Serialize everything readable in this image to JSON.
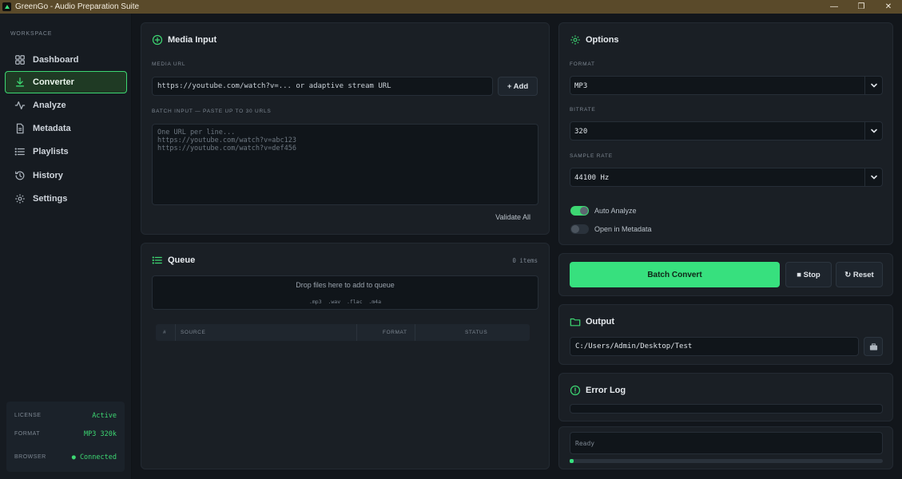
{
  "window": {
    "title": "GreenGo - Audio Preparation Suite",
    "controls": [
      "—",
      "❐",
      "✕"
    ]
  },
  "sidebar": {
    "section_label": "WORKSPACE",
    "items": [
      {
        "label": "Dashboard",
        "icon": "dashboard-icon"
      },
      {
        "label": "Converter",
        "icon": "download-icon",
        "active": true
      },
      {
        "label": "Analyze",
        "icon": "waveform-icon"
      },
      {
        "label": "Metadata",
        "icon": "document-icon"
      },
      {
        "label": "Playlists",
        "icon": "list-icon"
      },
      {
        "label": "History",
        "icon": "history-icon"
      },
      {
        "label": "Settings",
        "icon": "gear-icon"
      }
    ],
    "footer": {
      "license_label": "LICENSE",
      "license_value": "Active",
      "format_label": "FORMAT",
      "format_value": "MP3 320k",
      "browser_label": "BROWSER",
      "browser_value": "● Connected"
    }
  },
  "media_input": {
    "title": "Media Input",
    "url_label": "MEDIA URL",
    "url_placeholder": "https://youtube.com/watch?v=... or adaptive stream URL",
    "add_button": "+ Add",
    "batch_label": "BATCH INPUT — PASTE UP TO 30 URLS",
    "batch_placeholder": "One URL per line...\nhttps://youtube.com/watch?v=abc123\nhttps://youtube.com/watch?v=def456",
    "validate_button": "Validate All"
  },
  "queue": {
    "title": "Queue",
    "count": "0 items",
    "drop_text": "Drop files here to add to queue",
    "drop_formats": ".mp3  .wav  .flac  .m4a",
    "columns": [
      "#",
      "SOURCE",
      "FORMAT",
      "STATUS"
    ]
  },
  "options": {
    "title": "Options",
    "format_label": "FORMAT",
    "format_value": "MP3",
    "bitrate_label": "BITRATE",
    "bitrate_value": "320",
    "sample_rate_label": "SAMPLE RATE",
    "sample_rate_value": "44100 Hz",
    "toggles": [
      {
        "label": "Auto Analyze",
        "on": true
      },
      {
        "label": "Open in Metadata",
        "on": false
      }
    ]
  },
  "actions": {
    "batch_convert": "Batch Convert",
    "stop": "■ Stop",
    "reset": "↻ Reset"
  },
  "output": {
    "title": "Output",
    "path": "C:/Users/Admin/Desktop/Test"
  },
  "error_log": {
    "title": "Error Log"
  },
  "status": {
    "text": "Ready"
  },
  "colors": {
    "accent": "#37e07e",
    "background": "#12161b",
    "panel": "#1a1f25",
    "titlebar": "#5a4a2a"
  }
}
